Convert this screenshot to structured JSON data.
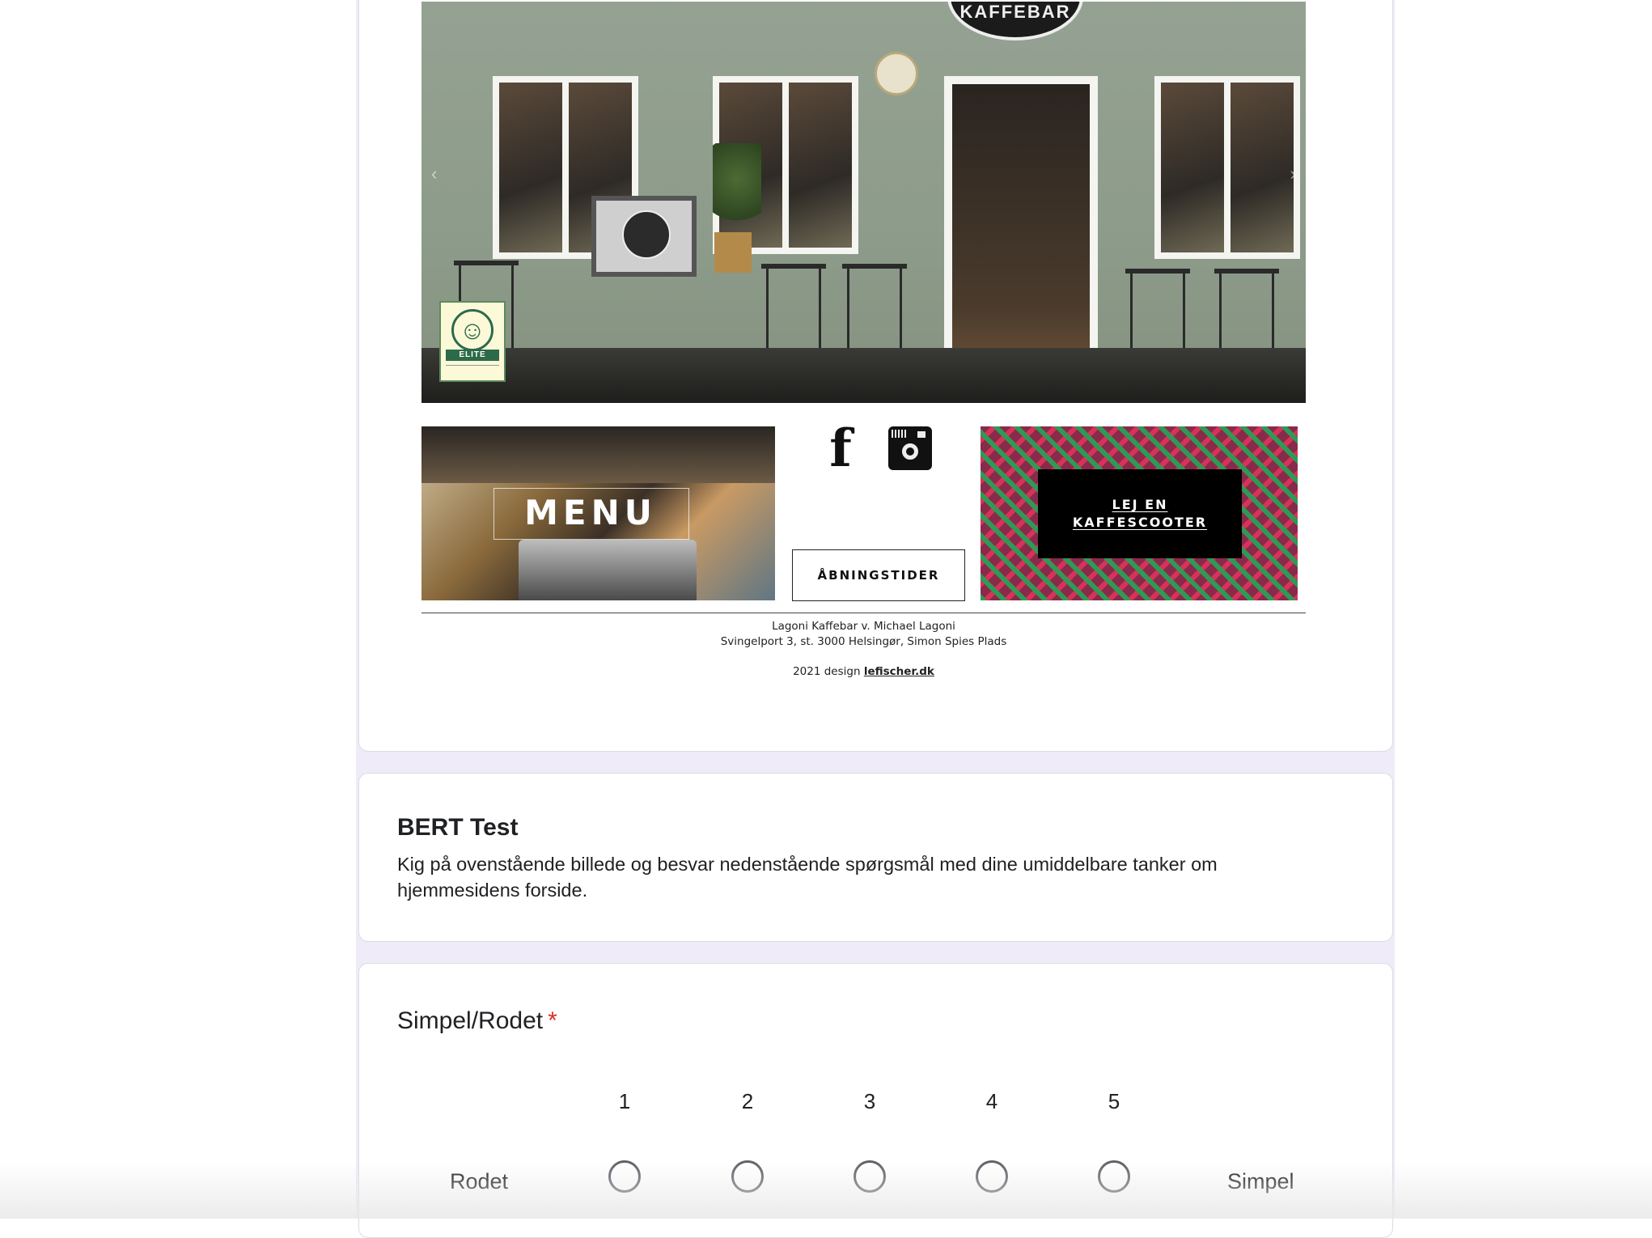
{
  "hero": {
    "sign_text": "KAFFEBAR",
    "smiley_badge": "ELITE"
  },
  "tiles": {
    "menu_label": "MENU",
    "hours_label": "ÅBNINGSTIDER",
    "scooter_line1": "LEJ EN",
    "scooter_line2": "KAFFESCOOTER",
    "icons": [
      "facebook-icon",
      "instagram-icon"
    ]
  },
  "footer": {
    "line1": "Lagoni Kaffebar v. Michael Lagoni",
    "line2": "Svingelport 3, st. 3000 Helsingør, Simon Spies Plads",
    "credit_prefix": "2021 design ",
    "credit_link": "lefischer.dk"
  },
  "section": {
    "title": "BERT Test",
    "description": "Kig på ovenstående billede og besvar nedenstående spørgsmål med dine umiddelbare tanker om hjemmesidens forside."
  },
  "question": {
    "title": "Simpel/Rodet",
    "required_marker": "*",
    "scale": [
      "1",
      "2",
      "3",
      "4",
      "5"
    ],
    "low_label": "Rodet",
    "high_label": "Simpel"
  },
  "colors": {
    "background": "#f0ebf8",
    "card": "#ffffff",
    "required": "#d93025",
    "radio_border": "#5f6368"
  }
}
